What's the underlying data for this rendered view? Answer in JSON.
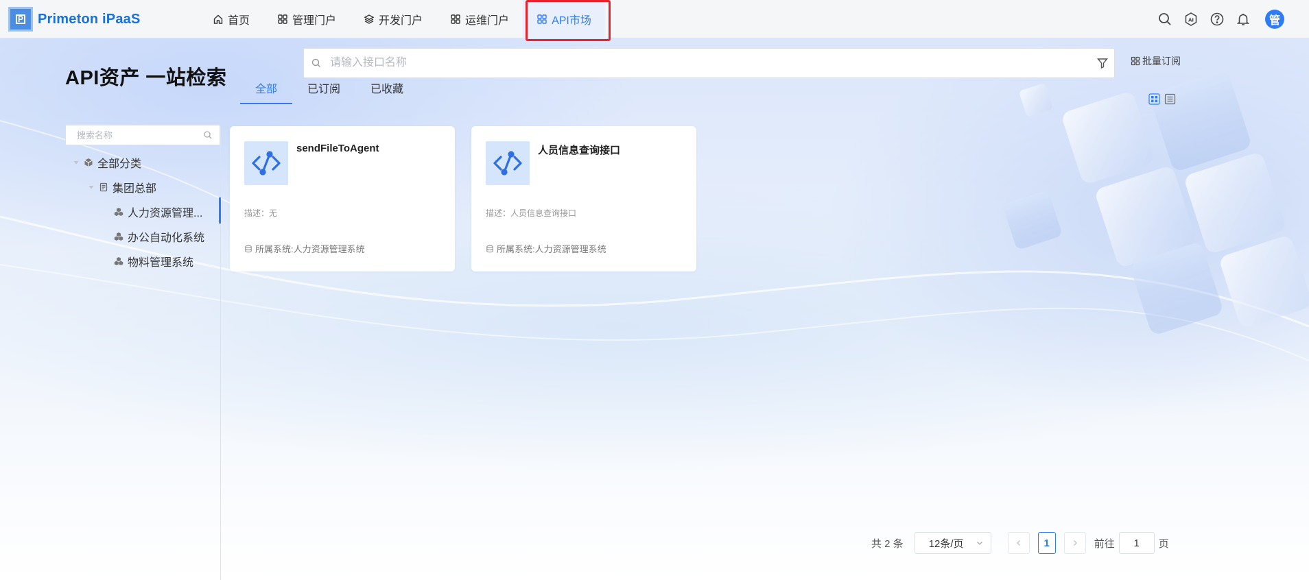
{
  "brand": {
    "name": "Primeton iPaaS"
  },
  "nav": {
    "items": [
      {
        "label": "首页",
        "icon": "home-icon"
      },
      {
        "label": "管理门户",
        "icon": "grid-icon"
      },
      {
        "label": "开发门户",
        "icon": "layers-icon"
      },
      {
        "label": "运维门户",
        "icon": "grid-icon"
      },
      {
        "label": "API市场",
        "icon": "grid-icon",
        "active": true
      }
    ]
  },
  "header_icons": [
    "search-icon",
    "ai-icon",
    "help-icon",
    "bell-icon"
  ],
  "user": {
    "avatar_text": "管"
  },
  "page": {
    "title": "API资产 一站检索"
  },
  "search": {
    "placeholder": "请输入接口名称"
  },
  "batch_subscribe": {
    "label": "批量订阅"
  },
  "tabs": [
    {
      "label": "全部",
      "active": true
    },
    {
      "label": "已订阅"
    },
    {
      "label": "已收藏"
    }
  ],
  "sidebar": {
    "search_placeholder": "搜索名称",
    "tree": [
      {
        "label": "全部分类",
        "level": 0
      },
      {
        "label": "集团总部",
        "level": 1
      },
      {
        "label": "人力资源管理...",
        "level": 2,
        "selected": true
      },
      {
        "label": "办公自动化系统",
        "level": 2
      },
      {
        "label": "物料管理系统",
        "level": 2
      }
    ]
  },
  "cards": [
    {
      "name": "sendFileToAgent",
      "description": "描述：无",
      "system": "所属系统:人力资源管理系统"
    },
    {
      "name": "人员信息查询接口",
      "description": "描述：人员信息查询接口",
      "system": "所属系统:人力资源管理系统"
    }
  ],
  "pagination": {
    "total_text": "共 2 条",
    "page_size": "12条/页",
    "current_page": "1",
    "goto_label": "前往",
    "goto_value": "1",
    "page_suffix": "页"
  },
  "colors": {
    "accent": "#2f7cf6",
    "highlight_border": "#e8222a",
    "brand": "#1a6fd8"
  }
}
